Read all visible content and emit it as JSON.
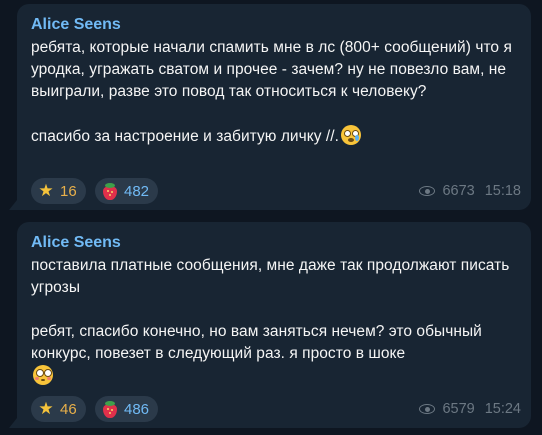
{
  "messages": [
    {
      "author": "Alice Seens",
      "text": "ребята, которые начали спамить мне в лс (800+ сообщений) что я уродка, угражать сватом и прочее - зачем? ну не повезло вам, не выиграли, разве это повод так относиться к человеку?\n\nспасибо за настроение и забитую личку //.",
      "emoji": "crying-face-icon",
      "reactions": [
        {
          "icon": "star-icon",
          "count": "16"
        },
        {
          "icon": "strawberry-icon",
          "count": "482"
        }
      ],
      "views": "6673",
      "time": "15:18"
    },
    {
      "author": "Alice Seens",
      "text": "поставила платные сообщения, мне даже так продолжают писать угрозы\n\nребят, спасибо конечно, но вам заняться нечем? это обычный конкурс, повезет в следующий раз. я просто в шоке",
      "emoji": "flushed-face-icon",
      "reactions": [
        {
          "icon": "star-icon",
          "count": "46"
        },
        {
          "icon": "strawberry-icon",
          "count": "486"
        }
      ],
      "views": "6579",
      "time": "15:24"
    }
  ],
  "colors": {
    "background": "#0e1621",
    "bubble": "#182533",
    "author": "#71baf5",
    "text": "#f5f5f5",
    "meta": "#6c7883",
    "reaction_bg": "#2b3a4a",
    "star_count": "#e8b04a",
    "strawberry_count": "#71baf5"
  }
}
